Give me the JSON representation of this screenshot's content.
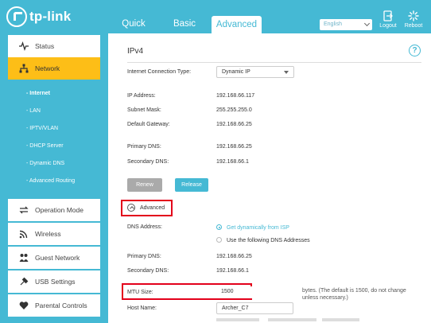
{
  "brand": {
    "name": "tp-link"
  },
  "tabs": [
    {
      "label": "Quick Setup"
    },
    {
      "label": "Basic"
    },
    {
      "label": "Advanced"
    }
  ],
  "header": {
    "language": "English",
    "logout_label": "Logout",
    "reboot_label": "Reboot"
  },
  "sidebar": {
    "items": [
      {
        "label": "Status",
        "icon": "pulse-icon"
      },
      {
        "label": "Network",
        "icon": "network-icon"
      },
      {
        "label": "Operation Mode",
        "icon": "swap-icon"
      },
      {
        "label": "Wireless",
        "icon": "wifi-icon"
      },
      {
        "label": "Guest Network",
        "icon": "guest-icon"
      },
      {
        "label": "USB Settings",
        "icon": "usb-icon"
      },
      {
        "label": "Parental Controls",
        "icon": "heart-icon"
      }
    ],
    "subitems": [
      {
        "label": "- Internet"
      },
      {
        "label": "- LAN"
      },
      {
        "label": "- IPTV/VLAN"
      },
      {
        "label": "- DHCP Server"
      },
      {
        "label": "- Dynamic DNS"
      },
      {
        "label": "- Advanced Routing"
      }
    ]
  },
  "main": {
    "section_title": "IPv4",
    "connection_type": {
      "label": "Internet Connection Type:",
      "value": "Dynamic IP"
    },
    "ip_address": {
      "label": "IP Address:",
      "value": "192.168.66.117"
    },
    "subnet_mask": {
      "label": "Subnet Mask:",
      "value": "255.255.255.0"
    },
    "default_gateway": {
      "label": "Default Gateway:",
      "value": "192.168.66.25"
    },
    "primary_dns": {
      "label": "Primary DNS:",
      "value": "192.168.66.25"
    },
    "secondary_dns": {
      "label": "Secondary DNS:",
      "value": "192.168.66.1"
    },
    "renew_label": "Renew",
    "release_label": "Release",
    "advanced_label": "Advanced",
    "dns_address": {
      "label": "DNS Address:",
      "option_auto": "Get dynamically from ISP",
      "option_manual": "Use the following DNS Addresses",
      "selected": "Get dynamically from ISP"
    },
    "adv_primary_dns": {
      "label": "Primary DNS:",
      "value": "192.168.66.25"
    },
    "adv_secondary_dns": {
      "label": "Secondary DNS:",
      "value": "192.168.66.1"
    },
    "mtu": {
      "label": "MTU Size:",
      "value": "1500",
      "note": "bytes. (The default is 1500, do not change unless necessary.)"
    },
    "host_name": {
      "label": "Host Name:",
      "value": "Archer_C7"
    }
  },
  "colors": {
    "accent": "#45b9d4",
    "active_nav": "#fdbe17",
    "highlight_box": "#e3001b"
  }
}
